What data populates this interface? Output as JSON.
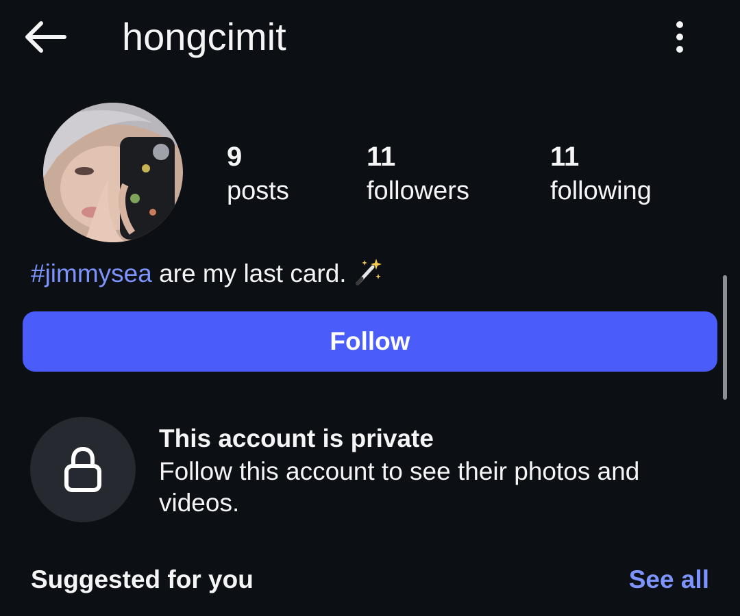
{
  "header": {
    "username": "hongcimit",
    "back_icon": "arrow-left-icon",
    "more_icon": "more-vertical-icon"
  },
  "profile": {
    "avatar_icon": "profile-avatar",
    "stats": [
      {
        "value": "9",
        "label": "posts"
      },
      {
        "value": "11",
        "label": "followers"
      },
      {
        "value": "11",
        "label": "following"
      }
    ],
    "bio": {
      "hashtag": "#jimmysea",
      "text": " are my last card.",
      "emoji_icon": "magic-wand-icon"
    }
  },
  "actions": {
    "follow_label": "Follow"
  },
  "private_notice": {
    "icon": "lock-icon",
    "title": "This account is private",
    "description": "Follow this account to see their photos and videos."
  },
  "suggested": {
    "title": "Suggested for you",
    "see_all_label": "See all"
  },
  "colors": {
    "background": "#0c0f14",
    "accent": "#4a5dfb",
    "link": "#7d94ff",
    "lock_bg": "#26292f"
  }
}
